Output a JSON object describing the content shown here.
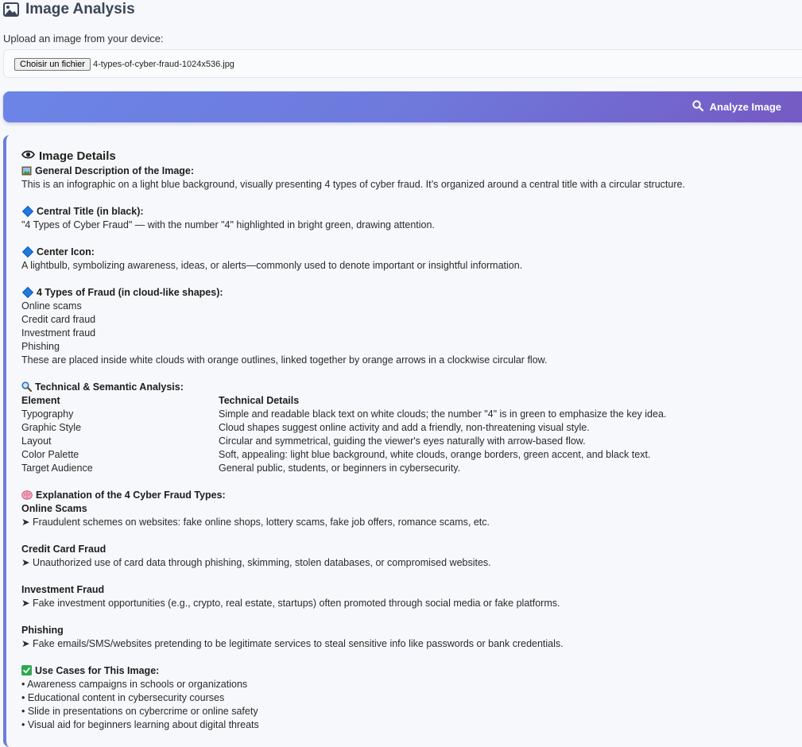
{
  "header": {
    "title": "Image Analysis",
    "icon": "image-icon"
  },
  "upload": {
    "label": "Upload an image from your device:",
    "button_label": "Choisir un fichier",
    "file_name": "4-types-of-cyber-fraud-1024x536.jpg"
  },
  "analyze": {
    "label": "Analyze Image",
    "icon": "search-icon"
  },
  "details": {
    "title": "Image Details",
    "icon": "eye-icon",
    "general": {
      "heading": "General Description of the Image:",
      "text": "This is an infographic on a light blue background, visually presenting 4 types of cyber fraud. It’s organized around a central title with a circular structure."
    },
    "central_title": {
      "heading": "Central Title (in black):",
      "text": "\"4 Types of Cyber Fraud\" — with the number \"4\" highlighted in bright green, drawing attention."
    },
    "center_icon": {
      "heading": "Center Icon:",
      "text": "A lightbulb, symbolizing awareness, ideas, or alerts—commonly used to denote important or insightful information."
    },
    "fraud_types": {
      "heading": "4 Types of Fraud (in cloud-like shapes):",
      "items": [
        "Online scams",
        "Credit card fraud",
        "Investment fraud",
        "Phishing"
      ],
      "note": "These are placed inside white clouds with orange outlines, linked together by orange arrows in a clockwise circular flow."
    },
    "technical": {
      "heading": "Technical & Semantic Analysis:",
      "col_element": "Element",
      "col_details": "Technical Details",
      "rows": [
        [
          "Typography",
          "Simple and readable black text on white clouds; the number \"4\" is in green to emphasize the key idea."
        ],
        [
          "Graphic Style",
          "Cloud shapes suggest online activity and add a friendly, non-threatening visual style."
        ],
        [
          "Layout",
          "Circular and symmetrical, guiding the viewer's eyes naturally with arrow-based flow."
        ],
        [
          "Color Palette",
          "Soft, appealing: light blue background, white clouds, orange borders, green accent, and black text."
        ],
        [
          "Target Audience",
          "General public, students, or beginners in cybersecurity."
        ]
      ]
    },
    "explanation": {
      "heading": "Explanation of the 4 Cyber Fraud Types:",
      "items": [
        {
          "title": "Online Scams",
          "text": "➤ Fraudulent schemes on websites: fake online shops, lottery scams, fake job offers, romance scams, etc."
        },
        {
          "title": "Credit Card Fraud",
          "text": "➤ Unauthorized use of card data through phishing, skimming, stolen databases, or compromised websites."
        },
        {
          "title": "Investment Fraud",
          "text": "➤ Fake investment opportunities (e.g., crypto, real estate, startups) often promoted through social media or fake platforms."
        },
        {
          "title": "Phishing",
          "text": "➤ Fake emails/SMS/websites pretending to be legitimate services to steal sensitive info like passwords or bank credentials."
        }
      ]
    },
    "use_cases": {
      "heading": "Use Cases for This Image:",
      "items": [
        "• Awareness campaigns in schools or organizations",
        "• Educational content in cybersecurity courses",
        "• Slide in presentations on cybercrime or online safety",
        "• Visual aid for beginners learning about digital threats"
      ]
    }
  }
}
